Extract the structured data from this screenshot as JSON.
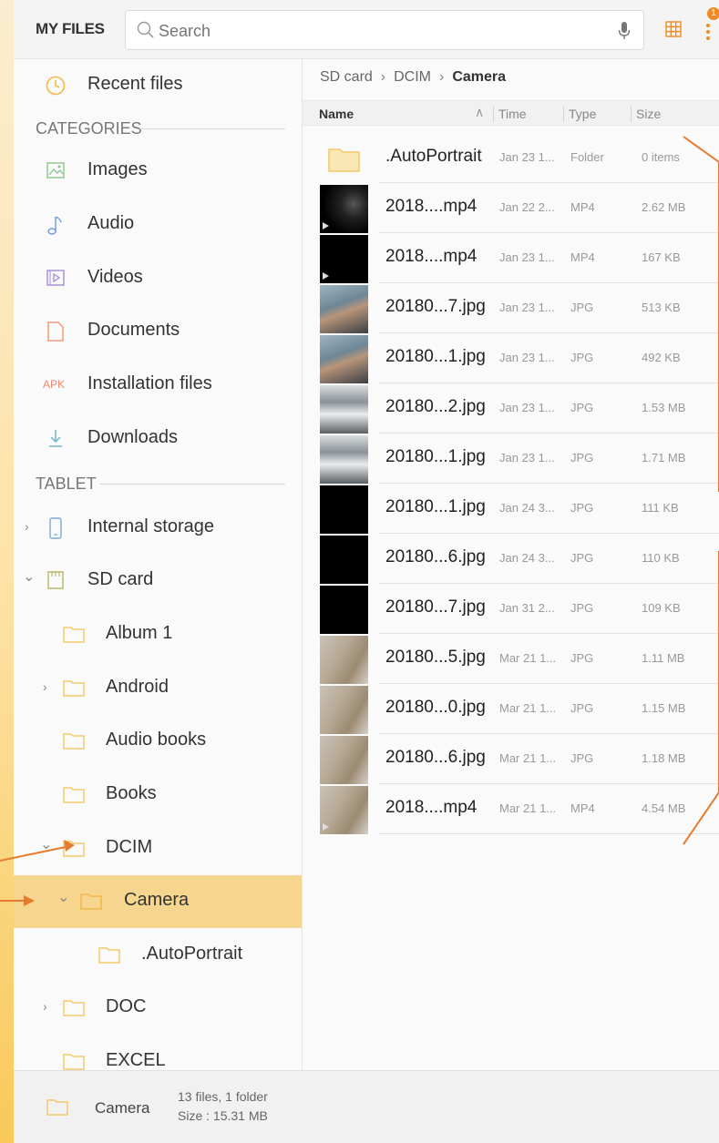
{
  "app_title": "MY FILES",
  "search": {
    "placeholder": "Search"
  },
  "badge_count": "1",
  "sidebar": {
    "recent_label": "Recent files",
    "categories_header": "CATEGORIES",
    "categories": [
      {
        "label": "Images",
        "icon": "image-icon"
      },
      {
        "label": "Audio",
        "icon": "music-note-icon"
      },
      {
        "label": "Videos",
        "icon": "video-icon"
      },
      {
        "label": "Documents",
        "icon": "document-icon"
      },
      {
        "label": "Installation files",
        "icon": "apk-icon",
        "icon_text": "APK"
      },
      {
        "label": "Downloads",
        "icon": "download-icon"
      }
    ],
    "tablet_header": "TABLET",
    "storage": [
      {
        "label": "Internal storage"
      },
      {
        "label": "SD card"
      }
    ],
    "tree": [
      {
        "label": "Album 1"
      },
      {
        "label": "Android"
      },
      {
        "label": "Audio books"
      },
      {
        "label": "Books"
      },
      {
        "label": "DCIM"
      },
      {
        "label": "Camera"
      },
      {
        "label": ".AutoPortrait"
      },
      {
        "label": "DOC"
      },
      {
        "label": "EXCEL"
      }
    ]
  },
  "breadcrumb": [
    "SD card",
    "DCIM",
    "Camera"
  ],
  "columns": {
    "name": "Name",
    "time": "Time",
    "type": "Type",
    "size": "Size"
  },
  "files": [
    {
      "name": ".AutoPortrait",
      "time": "Jan 23 1...",
      "type": "Folder",
      "size": "0 items",
      "thumb": "folder"
    },
    {
      "name": "2018....mp4",
      "time": "Jan 22 2...",
      "type": "MP4",
      "size": "2.62 MB",
      "thumb": "video-dark"
    },
    {
      "name": "2018....mp4",
      "time": "Jan 23 1...",
      "type": "MP4",
      "size": "167 KB",
      "thumb": "video-black"
    },
    {
      "name": "20180...7.jpg",
      "time": "Jan 23 1...",
      "type": "JPG",
      "size": "513 KB",
      "thumb": "face"
    },
    {
      "name": "20180...1.jpg",
      "time": "Jan 23 1...",
      "type": "JPG",
      "size": "492 KB",
      "thumb": "face"
    },
    {
      "name": "20180...2.jpg",
      "time": "Jan 23 1...",
      "type": "JPG",
      "size": "1.53 MB",
      "thumb": "snow"
    },
    {
      "name": "20180...1.jpg",
      "time": "Jan 23 1...",
      "type": "JPG",
      "size": "1.71 MB",
      "thumb": "snow"
    },
    {
      "name": "20180...1.jpg",
      "time": "Jan 24 3...",
      "type": "JPG",
      "size": "111 KB",
      "thumb": "black"
    },
    {
      "name": "20180...6.jpg",
      "time": "Jan 24 3...",
      "type": "JPG",
      "size": "110 KB",
      "thumb": "black"
    },
    {
      "name": "20180...7.jpg",
      "time": "Jan 31 2...",
      "type": "JPG",
      "size": "109 KB",
      "thumb": "black"
    },
    {
      "name": "20180...5.jpg",
      "time": "Mar 21 1...",
      "type": "JPG",
      "size": "1.11 MB",
      "thumb": "floor"
    },
    {
      "name": "20180...0.jpg",
      "time": "Mar 21 1...",
      "type": "JPG",
      "size": "1.15 MB",
      "thumb": "floor"
    },
    {
      "name": "20180...6.jpg",
      "time": "Mar 21 1...",
      "type": "JPG",
      "size": "1.18 MB",
      "thumb": "floor"
    },
    {
      "name": "2018....mp4",
      "time": "Mar 21 1...",
      "type": "MP4",
      "size": "4.54 MB",
      "thumb": "video-floor"
    }
  ],
  "footer": {
    "folder": "Camera",
    "count": "13 files, 1 folder",
    "size": "Size : 15.31 MB"
  },
  "colors": {
    "accent": "#f08a24",
    "selected": "#f6d58f",
    "folder": "#f3c96b"
  }
}
